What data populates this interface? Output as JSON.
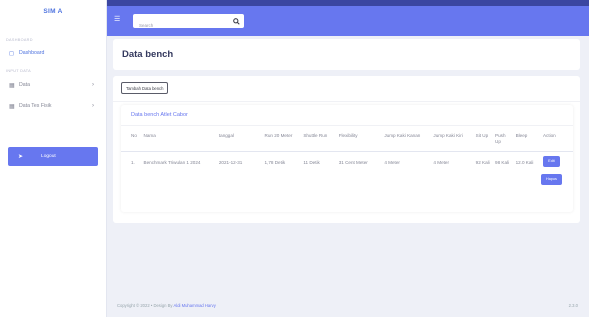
{
  "brand": {
    "title": "SIM A"
  },
  "sidebar": {
    "heading_dashboard": "DASHBOARD",
    "dashboard_label": "Dashboard",
    "heading_input": "INPUT DATA",
    "items": [
      {
        "label": "Data",
        "icon": "table-icon"
      },
      {
        "label": "Data Tes Fisik",
        "icon": "table-icon"
      }
    ],
    "logout_label": "Logout"
  },
  "topbar": {
    "search_placeholder": "Search",
    "accent": "#6777ef"
  },
  "page": {
    "title": "Data bench"
  },
  "content": {
    "add_button_label": "Tambah Data bench",
    "card_title": "Data bench Atlet Cabor"
  },
  "table": {
    "headers": [
      "No",
      "Nama",
      "tanggal",
      "Run 20 Meter",
      "Shuttle Run",
      "Flexibility",
      "Jump Kaki Kanan",
      "Jump Kaki Kiri",
      "Sit Up",
      "Push Up",
      "Bleep",
      "Action"
    ],
    "rows": [
      {
        "no": "1.",
        "nama": "Benchmark Triwulan 1 2024",
        "tanggal": "2021-12-31",
        "run20": "1,78 Detik",
        "shuttle": "11 Detik",
        "flex": "31 Cent Meter",
        "jump_kanan": "4 Meter",
        "jump_kiri": "4 Meter",
        "situp": "92 Kali",
        "pushup": "98 Kali",
        "bleep": "12.0 Kali",
        "edit_label": "Edit",
        "delete_label": "Hapus"
      }
    ]
  },
  "footer": {
    "prefix": "Copyright © 2022 • Design By",
    "author": "Aldi Muhammad Harvy",
    "version": "2.3.0"
  }
}
